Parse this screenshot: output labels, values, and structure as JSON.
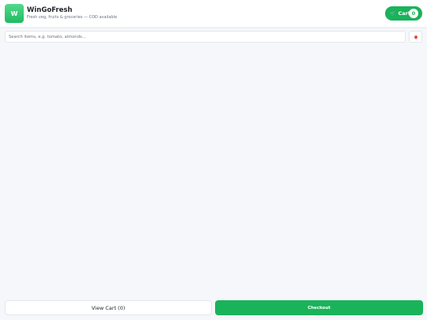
{
  "app": {
    "logo_letter": "W",
    "title": "WinGoFresh",
    "subtitle": "Fresh veg, fruits & groceries — COD available"
  },
  "header": {
    "cart_icon": "🛒",
    "cart_label": "Cart",
    "cart_count": "0"
  },
  "search": {
    "placeholder": "Search items, e.g. tomato, almonds...",
    "value": "",
    "location_icon": "location-pin-icon"
  },
  "footer": {
    "view_cart_label": "View Cart (0)",
    "checkout_label": "Checkout"
  },
  "colors": {
    "brand_green": "#19b35a",
    "logo_gradient_top": "#53d98a",
    "logo_gradient_bottom": "#1fbb63",
    "background": "#f5f7fa",
    "pin_red": "#e24a3b"
  }
}
